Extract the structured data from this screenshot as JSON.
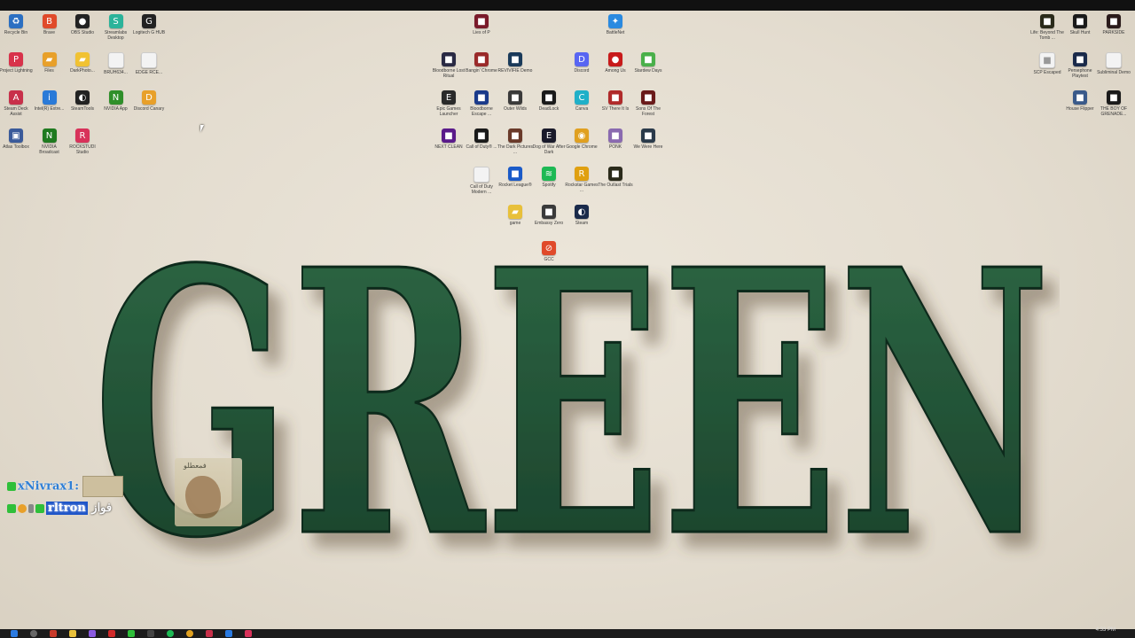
{
  "desktop": {
    "left_icons": [
      {
        "label": "Recycle Bin",
        "color": "#2b6fc2",
        "glyph": "♻"
      },
      {
        "label": "Brave",
        "color": "#e04a2a",
        "glyph": "B"
      },
      {
        "label": "OBS Studio",
        "color": "#222222",
        "glyph": "●"
      },
      {
        "label": "Streamlabs Desktop",
        "color": "#2bb39a",
        "glyph": "S"
      },
      {
        "label": "Logitech G HUB",
        "color": "#222222",
        "glyph": "G"
      },
      {
        "label": "Project Lightning",
        "color": "#d8324a",
        "glyph": "P"
      },
      {
        "label": "Files",
        "color": "#e8a02a",
        "glyph": "▰"
      },
      {
        "label": "DarkPhoto...",
        "color": "#f1c232",
        "glyph": "▰"
      },
      {
        "label": "BRUH634...",
        "color": "#f3f3f3",
        "glyph": " "
      },
      {
        "label": "EDGE RCE...",
        "color": "#f3f3f3",
        "glyph": " "
      },
      {
        "label": "Steam Deck Assist",
        "color": "#c8304a",
        "glyph": "A"
      },
      {
        "label": "Intel(R) Extre...",
        "color": "#2a7ad8",
        "glyph": "i"
      },
      {
        "label": "SteamTools",
        "color": "#222222",
        "glyph": "◐"
      },
      {
        "label": "NVIDIA App",
        "color": "#2f8f2a",
        "glyph": "N"
      },
      {
        "label": "Discord Canary",
        "color": "#e8a02a",
        "glyph": "D"
      },
      {
        "label": "Atlas Toolbox",
        "color": "#3a5a9a",
        "glyph": "▣"
      },
      {
        "label": "NVIDIA Broadcast",
        "color": "#1f7a1f",
        "glyph": "N"
      },
      {
        "label": "ROCKSTUDI Studio",
        "color": "#d8325a",
        "glyph": "R"
      }
    ],
    "middle_icons": [
      {
        "label": "Lies of P",
        "color": "#7a1a2a",
        "glyph": "■"
      },
      {
        "label": "BattleNet",
        "color": "#2a8ae0",
        "glyph": "✦"
      },
      {
        "label": "Bloodborne Lost Ritual",
        "color": "#2a2a44",
        "glyph": "■"
      },
      {
        "label": "Bangin' Chrome",
        "color": "#9a2a2a",
        "glyph": "■"
      },
      {
        "label": "REVIVIFIE Demo",
        "color": "#1a3a5a",
        "glyph": "■"
      },
      {
        "label": "Discord",
        "color": "#5865f2",
        "glyph": "D"
      },
      {
        "label": "Among Us",
        "color": "#c81a1a",
        "glyph": "●"
      },
      {
        "label": "Stardew Days",
        "color": "#4ab04a",
        "glyph": "■"
      },
      {
        "label": "Epic Games Launcher",
        "color": "#2a2a2a",
        "glyph": "E"
      },
      {
        "label": "Bloodborne Escape ...",
        "color": "#1a3a8a",
        "glyph": "■"
      },
      {
        "label": "Outer Wilds",
        "color": "#3a3a3a",
        "glyph": "■"
      },
      {
        "label": "DeadLock",
        "color": "#1a1a1a",
        "glyph": "■"
      },
      {
        "label": "Canva",
        "color": "#20b0c8",
        "glyph": "C"
      },
      {
        "label": "SV There It Is",
        "color": "#b02a2a",
        "glyph": "■"
      },
      {
        "label": "Sons Of The Forest",
        "color": "#6a1a1a",
        "glyph": "■"
      },
      {
        "label": "NEXT CLEAN",
        "color": "#5a1a8a",
        "glyph": "■"
      },
      {
        "label": "Call of Duty® ...",
        "color": "#1a1a1a",
        "glyph": "■"
      },
      {
        "label": "The Dark Pictures ...",
        "color": "#6a3a2a",
        "glyph": "■"
      },
      {
        "label": "Dog of War After Dark",
        "color": "#1a1a2a",
        "glyph": "E"
      },
      {
        "label": "Google Chrome",
        "color": "#e0a020",
        "glyph": "◉"
      },
      {
        "label": "PONK",
        "color": "#8a6ab0",
        "glyph": "■"
      },
      {
        "label": "We Were Here",
        "color": "#2a3a4a",
        "glyph": "■"
      },
      {
        "label": "Call of Duty Modern ...",
        "color": "#f3f3f3",
        "glyph": " "
      },
      {
        "label": "Rocket League®",
        "color": "#1a5ac8",
        "glyph": "■"
      },
      {
        "label": "Spotify",
        "color": "#1db954",
        "glyph": "≋"
      },
      {
        "label": "Rockstar Games ...",
        "color": "#e0a010",
        "glyph": "R"
      },
      {
        "label": "The Outlast Trials",
        "color": "#2a2a1a",
        "glyph": "■"
      },
      {
        "label": "game",
        "color": "#e8c03a",
        "glyph": "▰"
      },
      {
        "label": "Embassy Zero",
        "color": "#3a3a3a",
        "glyph": "■"
      },
      {
        "label": "Steam",
        "color": "#1a2a4a",
        "glyph": "◐"
      },
      {
        "label": "GCC",
        "color": "#e04a2a",
        "glyph": "⊘"
      }
    ],
    "right_icons": [
      {
        "label": "Life: Beyond The Tomb ...",
        "color": "#2a2a1a",
        "glyph": "■"
      },
      {
        "label": "Skull Hunt",
        "color": "#1a1a1a",
        "glyph": "■"
      },
      {
        "label": "PARKSIDE",
        "color": "#2a1a1a",
        "glyph": "■"
      },
      {
        "label": "SCP Escaped",
        "color": "#f3f3f3",
        "glyph": "■"
      },
      {
        "label": "Persephone Playtest",
        "color": "#1a2a4a",
        "glyph": "■"
      },
      {
        "label": "Subliminal Demo",
        "color": "#f3f3f3",
        "glyph": " "
      },
      {
        "label": "House Flipper",
        "color": "#3a5a8a",
        "glyph": "■"
      },
      {
        "label": "THE BOY OF GRENADE...",
        "color": "#1a1a1a",
        "glyph": "■"
      }
    ]
  },
  "wallpaper": {
    "word": "GREEN",
    "color": "#1f4f34"
  },
  "chat_overlay": {
    "line1_user": "xNivrax1:",
    "line2_user": "rltron",
    "line2_text": "فواز"
  },
  "sticker": {
    "caption": "فمعطلو"
  },
  "taskbar": {
    "time": "4:33 PM"
  }
}
